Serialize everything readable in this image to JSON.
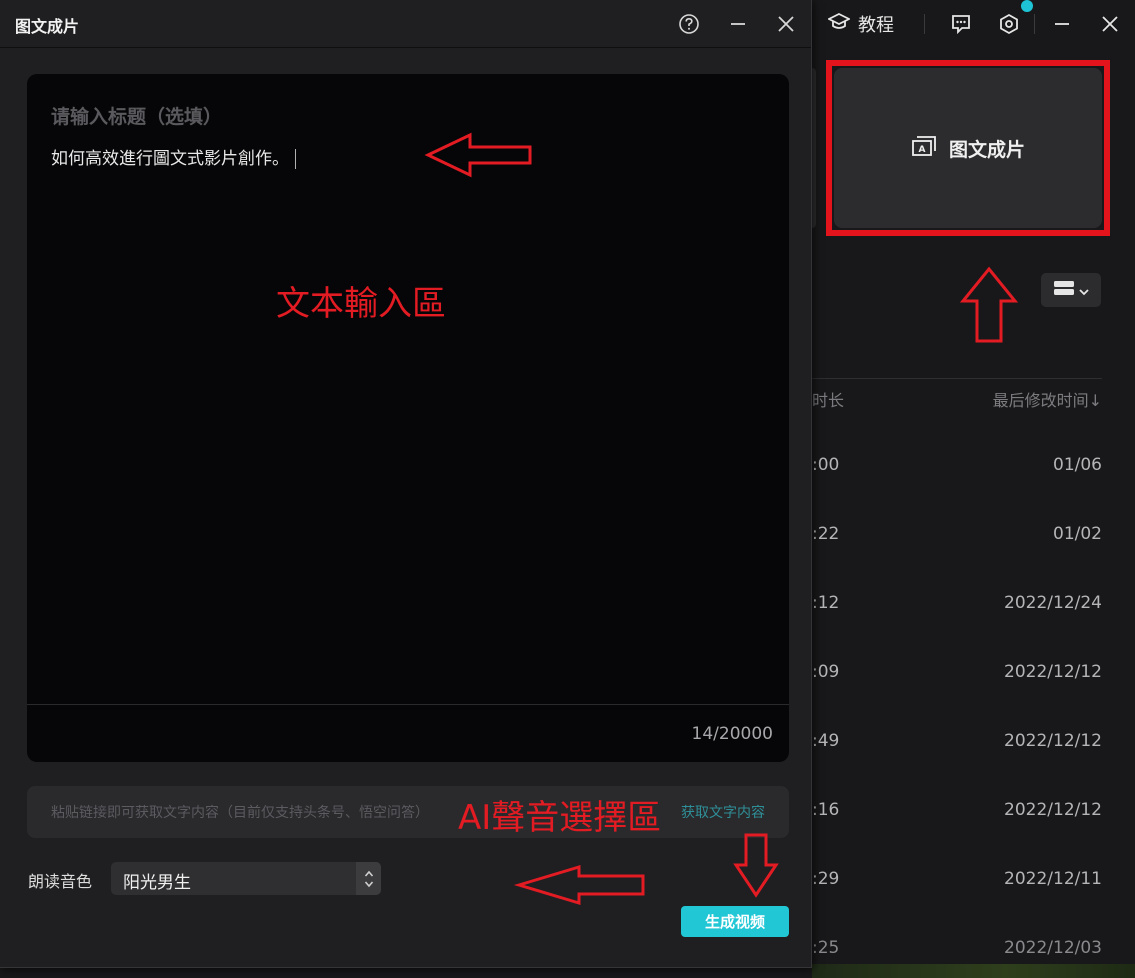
{
  "background": {
    "tutorial_label": "教程",
    "feature_card_label": "图文成片",
    "table_headers": {
      "duration": "时长",
      "modified": "最后修改时间↓"
    },
    "rows": [
      {
        "duration": ":00",
        "modified": "01/06"
      },
      {
        "duration": ":22",
        "modified": "01/02"
      },
      {
        "duration": ":12",
        "modified": "2022/12/24"
      },
      {
        "duration": ":09",
        "modified": "2022/12/12"
      },
      {
        "duration": ":49",
        "modified": "2022/12/12"
      },
      {
        "duration": ":16",
        "modified": "2022/12/12"
      },
      {
        "duration": ":29",
        "modified": "2022/12/11"
      },
      {
        "duration": ":25",
        "modified": "2022/12/03"
      }
    ],
    "icons": [
      "graduation-cap-icon",
      "feedback-icon",
      "settings-hex-icon",
      "minimize-icon",
      "close-icon",
      "list-view-icon",
      "chevron-down-icon"
    ]
  },
  "dialog": {
    "title": "图文成片",
    "editor": {
      "title_placeholder": "请输入标题（选填）",
      "body_text": "如何高效進行圖文式影片創作。",
      "char_count": "14/20000"
    },
    "link_input": {
      "placeholder": "粘贴链接即可获取文字内容（目前仅支持头条号、悟空问答）",
      "action_label": "获取文字内容"
    },
    "voice": {
      "label": "朗读音色",
      "selected": "阳光男生"
    },
    "generate_label": "生成视频"
  },
  "annotations": {
    "text_area_label": "文本輸入區",
    "voice_area_label": "AI聲音選擇區",
    "color": "#e31b23"
  }
}
